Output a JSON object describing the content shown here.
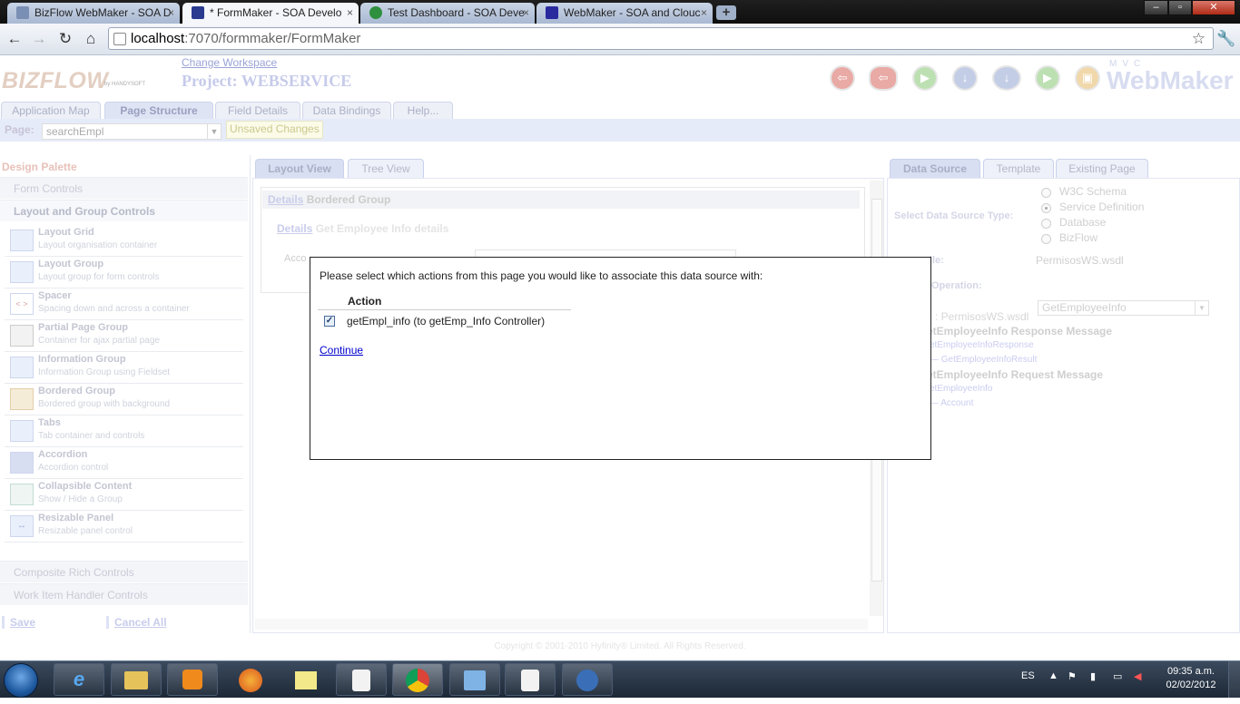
{
  "browser": {
    "tabs": [
      {
        "title": "BizFlow WebMaker - SOA D",
        "close": "×"
      },
      {
        "title": "* FormMaker - SOA Develo",
        "close": "×"
      },
      {
        "title": "Test Dashboard - SOA Deve",
        "close": "×"
      },
      {
        "title": "WebMaker - SOA and Clouc",
        "close": "×"
      }
    ],
    "new_tab": "+",
    "url_host": "localhost",
    "url_rest": ":7070/formmaker/FormMaker",
    "window_buttons": [
      "–",
      "▫",
      "✕"
    ]
  },
  "app": {
    "logo": "BIZFLOW",
    "logo_sub": "by HANDYSOFT",
    "change_workspace": "Change Workspace",
    "project_title": "Project: WEBSERVICE",
    "brand_mvc": "MVC",
    "brand_name": "WebMaker",
    "tabs": [
      "Application Map",
      "Page Structure",
      "Field Details",
      "Data Bindings",
      "Help..."
    ],
    "page_label": "Page:",
    "page_value": "searchEmpl",
    "unsaved": "Unsaved Changes"
  },
  "palette": {
    "title": "Design Palette",
    "sections": [
      "Form Controls",
      "Layout and Group Controls",
      "Composite Rich Controls",
      "Work Item Handler Controls"
    ],
    "items": [
      {
        "name": "Layout Grid",
        "desc": "Layout organisation container"
      },
      {
        "name": "Layout Group",
        "desc": "Layout group for form controls"
      },
      {
        "name": "Spacer",
        "desc": "Spacing down and across a container"
      },
      {
        "name": "Partial Page Group",
        "desc": "Container for ajax partial page"
      },
      {
        "name": "Information Group",
        "desc": "Information Group using Fieldset"
      },
      {
        "name": "Bordered Group",
        "desc": "Bordered group with background"
      },
      {
        "name": "Tabs",
        "desc": "Tab container and controls"
      },
      {
        "name": "Accordion",
        "desc": "Accordion control"
      },
      {
        "name": "Collapsible Content",
        "desc": "Show / Hide a Group"
      },
      {
        "name": "Resizable Panel",
        "desc": "Resizable panel control"
      }
    ],
    "save": "Save",
    "cancel": "Cancel All"
  },
  "center": {
    "tabs": [
      "Layout View",
      "Tree View"
    ],
    "group_link": "Details",
    "group_text": "Bordered Group",
    "sub_link": "Details",
    "sub_text": "Get Employee Info details",
    "field_label": "Acco"
  },
  "right": {
    "tabs": [
      "Data Source",
      "Template",
      "Existing Page"
    ],
    "ds_type_label": "Select Data Source Type:",
    "ds_types": [
      "W3C Schema",
      "Service Definition",
      "Database",
      "BizFlow"
    ],
    "file_label": "ile:",
    "file_value": "PermisosWS.wsdl",
    "op_label": "Operation:",
    "op_value": "GetEmployeeInfo",
    "tree": [
      ": PermisosWS.wsdl",
      "etEmployeeInfo Response Message",
      "etEmployeeInfoResponse",
      "— GetEmployeeInfoResult",
      "etEmployeeInfo Request Message",
      "etEmployeeInfo",
      "— Account"
    ]
  },
  "copyright": "Copyright © 2001-2010 Hyfinity® Limited. All Rights Reserved.",
  "modal": {
    "message": "Please select which actions from this page you would like to associate this data source with:",
    "column_header": "Action",
    "action_item": "getEmpl_info (to getEmp_Info Controller)",
    "checked": true,
    "continue": "Continue"
  },
  "taskbar": {
    "lang": "ES",
    "time": "09:35 a.m.",
    "date": "02/02/2012"
  }
}
